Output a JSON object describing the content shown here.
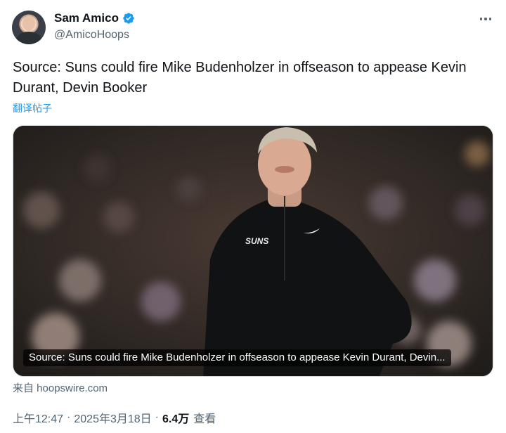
{
  "author": {
    "display_name": "Sam Amico",
    "handle": "@AmicoHoops",
    "verified": true
  },
  "tweet": {
    "text": "Source: Suns could fire Mike Budenholzer in offseason to appease Kevin Durant, Devin Booker",
    "translate_label": "翻译帖子"
  },
  "link_card": {
    "caption": "Source: Suns could fire Mike Budenholzer in offseason to appease Kevin Durant, Devin...",
    "source": "来自 hoopswire.com",
    "jersey_text": "SUNS"
  },
  "meta": {
    "time": "上午12:47",
    "separator": "·",
    "date": "2025年3月18日",
    "views_count": "6.4万",
    "views_label": "查看"
  },
  "colors": {
    "accent": "#1d9bf0",
    "muted": "#536471",
    "text": "#0f1419"
  }
}
